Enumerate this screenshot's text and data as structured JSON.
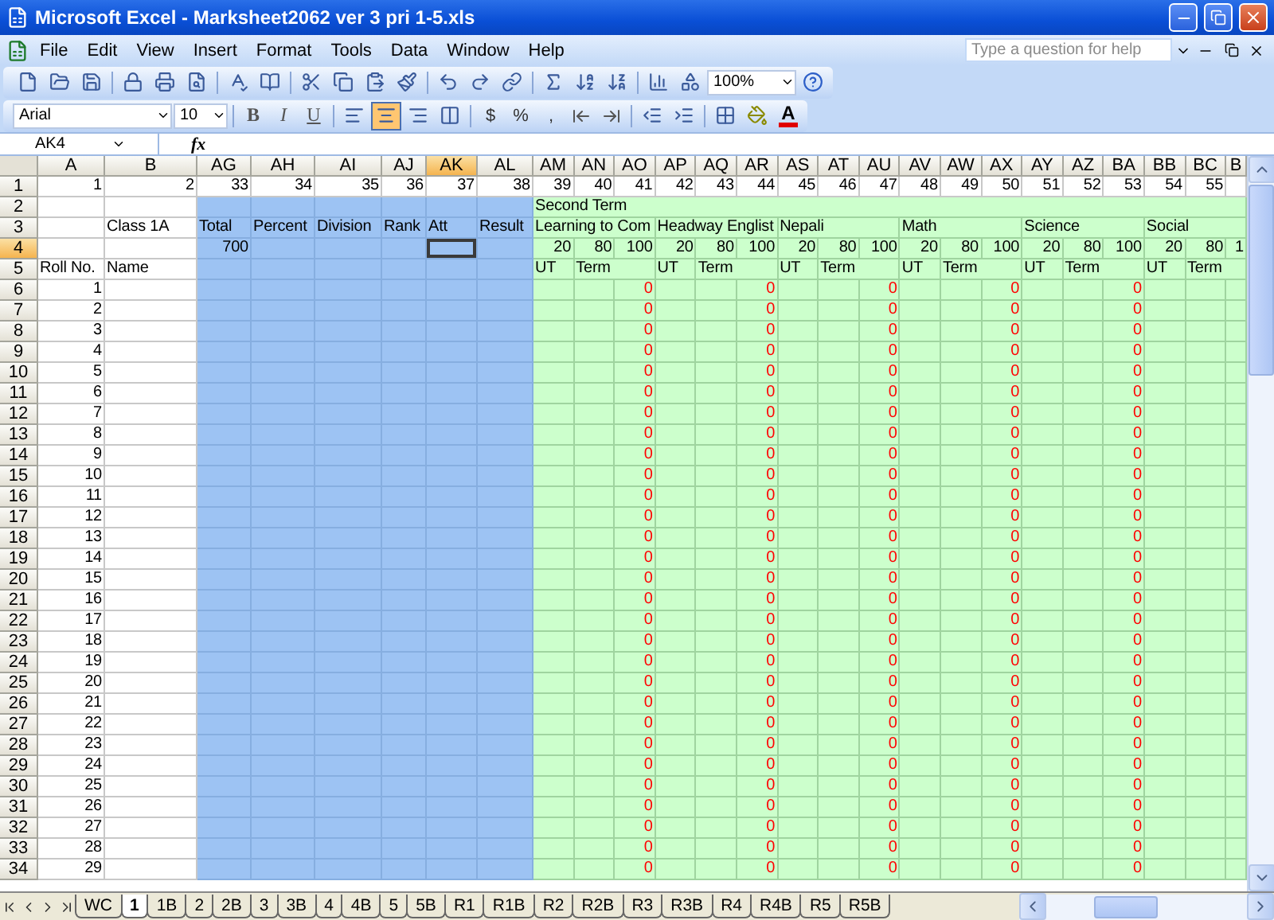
{
  "window": {
    "title": "Microsoft Excel - Marksheet2062 ver 3 pri 1-5.xls"
  },
  "menu": [
    "File",
    "Edit",
    "View",
    "Insert",
    "Format",
    "Tools",
    "Data",
    "Window",
    "Help"
  ],
  "help": {
    "placeholder": "Type a question for help"
  },
  "toolbar": {
    "zoom": "100%"
  },
  "formatting": {
    "font": "Arial",
    "size": "10",
    "styles": [
      "B",
      "I",
      "U"
    ],
    "number_formats": [
      "$",
      "%",
      ","
    ],
    "alignment": [
      {
        "kind": "left",
        "selected": false
      },
      {
        "kind": "center",
        "selected": true
      },
      {
        "kind": "right",
        "selected": false
      },
      {
        "kind": "merge",
        "selected": false
      }
    ],
    "font_color": "A"
  },
  "formula_bar": {
    "name_box": "AK4",
    "label": "fx"
  },
  "columns": [
    {
      "label": "A",
      "selected": false,
      "kind": "plain"
    },
    {
      "label": "B",
      "selected": false,
      "kind": "plain"
    },
    {
      "label": "AG",
      "selected": false,
      "kind": "summary"
    },
    {
      "label": "AH",
      "selected": false,
      "kind": "summary"
    },
    {
      "label": "AI",
      "selected": false,
      "kind": "summary"
    },
    {
      "label": "AJ",
      "selected": false,
      "kind": "summary"
    },
    {
      "label": "AK",
      "selected": true,
      "kind": "summary"
    },
    {
      "label": "AL",
      "selected": false,
      "kind": "summary"
    },
    {
      "label": "AM",
      "selected": false,
      "kind": "marks"
    },
    {
      "label": "AN",
      "selected": false,
      "kind": "marks"
    },
    {
      "label": "AO",
      "selected": false,
      "kind": "total"
    },
    {
      "label": "AP",
      "selected": false,
      "kind": "marks"
    },
    {
      "label": "AQ",
      "selected": false,
      "kind": "marks"
    },
    {
      "label": "AR",
      "selected": false,
      "kind": "total"
    },
    {
      "label": "AS",
      "selected": false,
      "kind": "marks"
    },
    {
      "label": "AT",
      "selected": false,
      "kind": "marks"
    },
    {
      "label": "AU",
      "selected": false,
      "kind": "total"
    },
    {
      "label": "AV",
      "selected": false,
      "kind": "marks"
    },
    {
      "label": "AW",
      "selected": false,
      "kind": "marks"
    },
    {
      "label": "AX",
      "selected": false,
      "kind": "total"
    },
    {
      "label": "AY",
      "selected": false,
      "kind": "marks"
    },
    {
      "label": "AZ",
      "selected": false,
      "kind": "marks"
    },
    {
      "label": "BA",
      "selected": false,
      "kind": "total"
    },
    {
      "label": "BB",
      "selected": false,
      "kind": "marks"
    },
    {
      "label": "BC",
      "selected": false,
      "kind": "marks"
    },
    {
      "label": "B",
      "selected": false,
      "kind": "marks"
    }
  ],
  "rows": [
    {
      "header": "1",
      "selected": false,
      "kind": "numbers",
      "cells": [
        "1",
        "2",
        "33",
        "34",
        "35",
        "36",
        "37",
        "38",
        "39",
        "40",
        "41",
        "42",
        "43",
        "44",
        "45",
        "46",
        "47",
        "48",
        "49",
        "50",
        "51",
        "52",
        "53",
        "54",
        "55",
        ""
      ]
    },
    {
      "header": "2",
      "selected": false,
      "kind": "header",
      "cells": [
        "",
        "",
        "",
        "",
        "",
        "",
        "",
        "",
        "Second Term",
        "",
        "",
        "",
        "",
        "",
        "",
        "",
        "",
        "",
        "",
        "",
        "",
        "",
        "",
        "",
        "",
        ""
      ]
    },
    {
      "header": "3",
      "selected": false,
      "kind": "header",
      "cells": [
        "",
        "Class 1A",
        "Total",
        "Percent",
        "Division",
        "Rank",
        "Att",
        "Result",
        "Learning to Com",
        "",
        "",
        "Headway Englist",
        "",
        "",
        "Nepali",
        "",
        "",
        "Math",
        "",
        "",
        "Science",
        "",
        "",
        "Social",
        "",
        ""
      ]
    },
    {
      "header": "4",
      "selected": true,
      "kind": "header",
      "cells": [
        "",
        "",
        "700",
        "",
        "",
        "",
        "",
        "",
        "20",
        "80",
        "100",
        "20",
        "80",
        "100",
        "20",
        "80",
        "100",
        "20",
        "80",
        "100",
        "20",
        "80",
        "100",
        "20",
        "80",
        "1"
      ]
    },
    {
      "header": "5",
      "selected": false,
      "kind": "header",
      "cells": [
        "Roll No.",
        "Name",
        "",
        "",
        "",
        "",
        "",
        "",
        "UT",
        "Term",
        "",
        "UT",
        "Term",
        "",
        "UT",
        "Term",
        "",
        "UT",
        "Term",
        "",
        "UT",
        "Term",
        "",
        "UT",
        "Term",
        ""
      ]
    },
    {
      "header": "6",
      "selected": false,
      "kind": "data",
      "cells": [
        "1",
        "",
        "",
        "",
        "",
        "",
        "",
        "",
        "",
        "",
        "0",
        "",
        "",
        "0",
        "",
        "",
        "0",
        "",
        "",
        "0",
        "",
        "",
        "0",
        "",
        "",
        ""
      ]
    },
    {
      "header": "7",
      "selected": false,
      "kind": "data",
      "cells": [
        "2",
        "",
        "",
        "",
        "",
        "",
        "",
        "",
        "",
        "",
        "0",
        "",
        "",
        "0",
        "",
        "",
        "0",
        "",
        "",
        "0",
        "",
        "",
        "0",
        "",
        "",
        ""
      ]
    },
    {
      "header": "8",
      "selected": false,
      "kind": "data",
      "cells": [
        "3",
        "",
        "",
        "",
        "",
        "",
        "",
        "",
        "",
        "",
        "0",
        "",
        "",
        "0",
        "",
        "",
        "0",
        "",
        "",
        "0",
        "",
        "",
        "0",
        "",
        "",
        ""
      ]
    },
    {
      "header": "9",
      "selected": false,
      "kind": "data",
      "cells": [
        "4",
        "",
        "",
        "",
        "",
        "",
        "",
        "",
        "",
        "",
        "0",
        "",
        "",
        "0",
        "",
        "",
        "0",
        "",
        "",
        "0",
        "",
        "",
        "0",
        "",
        "",
        ""
      ]
    },
    {
      "header": "10",
      "selected": false,
      "kind": "data",
      "cells": [
        "5",
        "",
        "",
        "",
        "",
        "",
        "",
        "",
        "",
        "",
        "0",
        "",
        "",
        "0",
        "",
        "",
        "0",
        "",
        "",
        "0",
        "",
        "",
        "0",
        "",
        "",
        ""
      ]
    },
    {
      "header": "11",
      "selected": false,
      "kind": "data",
      "cells": [
        "6",
        "",
        "",
        "",
        "",
        "",
        "",
        "",
        "",
        "",
        "0",
        "",
        "",
        "0",
        "",
        "",
        "0",
        "",
        "",
        "0",
        "",
        "",
        "0",
        "",
        "",
        ""
      ]
    },
    {
      "header": "12",
      "selected": false,
      "kind": "data",
      "cells": [
        "7",
        "",
        "",
        "",
        "",
        "",
        "",
        "",
        "",
        "",
        "0",
        "",
        "",
        "0",
        "",
        "",
        "0",
        "",
        "",
        "0",
        "",
        "",
        "0",
        "",
        "",
        ""
      ]
    },
    {
      "header": "13",
      "selected": false,
      "kind": "data",
      "cells": [
        "8",
        "",
        "",
        "",
        "",
        "",
        "",
        "",
        "",
        "",
        "0",
        "",
        "",
        "0",
        "",
        "",
        "0",
        "",
        "",
        "0",
        "",
        "",
        "0",
        "",
        "",
        ""
      ]
    },
    {
      "header": "14",
      "selected": false,
      "kind": "data",
      "cells": [
        "9",
        "",
        "",
        "",
        "",
        "",
        "",
        "",
        "",
        "",
        "0",
        "",
        "",
        "0",
        "",
        "",
        "0",
        "",
        "",
        "0",
        "",
        "",
        "0",
        "",
        "",
        ""
      ]
    },
    {
      "header": "15",
      "selected": false,
      "kind": "data",
      "cells": [
        "10",
        "",
        "",
        "",
        "",
        "",
        "",
        "",
        "",
        "",
        "0",
        "",
        "",
        "0",
        "",
        "",
        "0",
        "",
        "",
        "0",
        "",
        "",
        "0",
        "",
        "",
        ""
      ]
    },
    {
      "header": "16",
      "selected": false,
      "kind": "data",
      "cells": [
        "11",
        "",
        "",
        "",
        "",
        "",
        "",
        "",
        "",
        "",
        "0",
        "",
        "",
        "0",
        "",
        "",
        "0",
        "",
        "",
        "0",
        "",
        "",
        "0",
        "",
        "",
        ""
      ]
    },
    {
      "header": "17",
      "selected": false,
      "kind": "data",
      "cells": [
        "12",
        "",
        "",
        "",
        "",
        "",
        "",
        "",
        "",
        "",
        "0",
        "",
        "",
        "0",
        "",
        "",
        "0",
        "",
        "",
        "0",
        "",
        "",
        "0",
        "",
        "",
        ""
      ]
    },
    {
      "header": "18",
      "selected": false,
      "kind": "data",
      "cells": [
        "13",
        "",
        "",
        "",
        "",
        "",
        "",
        "",
        "",
        "",
        "0",
        "",
        "",
        "0",
        "",
        "",
        "0",
        "",
        "",
        "0",
        "",
        "",
        "0",
        "",
        "",
        ""
      ]
    },
    {
      "header": "19",
      "selected": false,
      "kind": "data",
      "cells": [
        "14",
        "",
        "",
        "",
        "",
        "",
        "",
        "",
        "",
        "",
        "0",
        "",
        "",
        "0",
        "",
        "",
        "0",
        "",
        "",
        "0",
        "",
        "",
        "0",
        "",
        "",
        ""
      ]
    },
    {
      "header": "20",
      "selected": false,
      "kind": "data",
      "cells": [
        "15",
        "",
        "",
        "",
        "",
        "",
        "",
        "",
        "",
        "",
        "0",
        "",
        "",
        "0",
        "",
        "",
        "0",
        "",
        "",
        "0",
        "",
        "",
        "0",
        "",
        "",
        ""
      ]
    },
    {
      "header": "21",
      "selected": false,
      "kind": "data",
      "cells": [
        "16",
        "",
        "",
        "",
        "",
        "",
        "",
        "",
        "",
        "",
        "0",
        "",
        "",
        "0",
        "",
        "",
        "0",
        "",
        "",
        "0",
        "",
        "",
        "0",
        "",
        "",
        ""
      ]
    },
    {
      "header": "22",
      "selected": false,
      "kind": "data",
      "cells": [
        "17",
        "",
        "",
        "",
        "",
        "",
        "",
        "",
        "",
        "",
        "0",
        "",
        "",
        "0",
        "",
        "",
        "0",
        "",
        "",
        "0",
        "",
        "",
        "0",
        "",
        "",
        ""
      ]
    },
    {
      "header": "23",
      "selected": false,
      "kind": "data",
      "cells": [
        "18",
        "",
        "",
        "",
        "",
        "",
        "",
        "",
        "",
        "",
        "0",
        "",
        "",
        "0",
        "",
        "",
        "0",
        "",
        "",
        "0",
        "",
        "",
        "0",
        "",
        "",
        ""
      ]
    },
    {
      "header": "24",
      "selected": false,
      "kind": "data",
      "cells": [
        "19",
        "",
        "",
        "",
        "",
        "",
        "",
        "",
        "",
        "",
        "0",
        "",
        "",
        "0",
        "",
        "",
        "0",
        "",
        "",
        "0",
        "",
        "",
        "0",
        "",
        "",
        ""
      ]
    },
    {
      "header": "25",
      "selected": false,
      "kind": "data",
      "cells": [
        "20",
        "",
        "",
        "",
        "",
        "",
        "",
        "",
        "",
        "",
        "0",
        "",
        "",
        "0",
        "",
        "",
        "0",
        "",
        "",
        "0",
        "",
        "",
        "0",
        "",
        "",
        ""
      ]
    },
    {
      "header": "26",
      "selected": false,
      "kind": "data",
      "cells": [
        "21",
        "",
        "",
        "",
        "",
        "",
        "",
        "",
        "",
        "",
        "0",
        "",
        "",
        "0",
        "",
        "",
        "0",
        "",
        "",
        "0",
        "",
        "",
        "0",
        "",
        "",
        ""
      ]
    },
    {
      "header": "27",
      "selected": false,
      "kind": "data",
      "cells": [
        "22",
        "",
        "",
        "",
        "",
        "",
        "",
        "",
        "",
        "",
        "0",
        "",
        "",
        "0",
        "",
        "",
        "0",
        "",
        "",
        "0",
        "",
        "",
        "0",
        "",
        "",
        ""
      ]
    },
    {
      "header": "28",
      "selected": false,
      "kind": "data",
      "cells": [
        "23",
        "",
        "",
        "",
        "",
        "",
        "",
        "",
        "",
        "",
        "0",
        "",
        "",
        "0",
        "",
        "",
        "0",
        "",
        "",
        "0",
        "",
        "",
        "0",
        "",
        "",
        ""
      ]
    },
    {
      "header": "29",
      "selected": false,
      "kind": "data",
      "cells": [
        "24",
        "",
        "",
        "",
        "",
        "",
        "",
        "",
        "",
        "",
        "0",
        "",
        "",
        "0",
        "",
        "",
        "0",
        "",
        "",
        "0",
        "",
        "",
        "0",
        "",
        "",
        ""
      ]
    },
    {
      "header": "30",
      "selected": false,
      "kind": "data",
      "cells": [
        "25",
        "",
        "",
        "",
        "",
        "",
        "",
        "",
        "",
        "",
        "0",
        "",
        "",
        "0",
        "",
        "",
        "0",
        "",
        "",
        "0",
        "",
        "",
        "0",
        "",
        "",
        ""
      ]
    },
    {
      "header": "31",
      "selected": false,
      "kind": "data",
      "cells": [
        "26",
        "",
        "",
        "",
        "",
        "",
        "",
        "",
        "",
        "",
        "0",
        "",
        "",
        "0",
        "",
        "",
        "0",
        "",
        "",
        "0",
        "",
        "",
        "0",
        "",
        "",
        ""
      ]
    },
    {
      "header": "32",
      "selected": false,
      "kind": "data",
      "cells": [
        "27",
        "",
        "",
        "",
        "",
        "",
        "",
        "",
        "",
        "",
        "0",
        "",
        "",
        "0",
        "",
        "",
        "0",
        "",
        "",
        "0",
        "",
        "",
        "0",
        "",
        "",
        ""
      ]
    },
    {
      "header": "33",
      "selected": false,
      "kind": "data",
      "cells": [
        "28",
        "",
        "",
        "",
        "",
        "",
        "",
        "",
        "",
        "",
        "0",
        "",
        "",
        "0",
        "",
        "",
        "0",
        "",
        "",
        "0",
        "",
        "",
        "0",
        "",
        "",
        ""
      ]
    },
    {
      "header": "34",
      "selected": false,
      "kind": "data",
      "cells": [
        "29",
        "",
        "",
        "",
        "",
        "",
        "",
        "",
        "",
        "",
        "0",
        "",
        "",
        "0",
        "",
        "",
        "0",
        "",
        "",
        "0",
        "",
        "",
        "0",
        "",
        "",
        ""
      ]
    }
  ],
  "sheet_tabs": [
    {
      "label": "WC",
      "selected": false
    },
    {
      "label": "1",
      "selected": true
    },
    {
      "label": "1B",
      "selected": false
    },
    {
      "label": "2",
      "selected": false
    },
    {
      "label": "2B",
      "selected": false
    },
    {
      "label": "3",
      "selected": false
    },
    {
      "label": "3B",
      "selected": false
    },
    {
      "label": "4",
      "selected": false
    },
    {
      "label": "4B",
      "selected": false
    },
    {
      "label": "5",
      "selected": false
    },
    {
      "label": "5B",
      "selected": false
    },
    {
      "label": "R1",
      "selected": false
    },
    {
      "label": "R1B",
      "selected": false
    },
    {
      "label": "R2",
      "selected": false
    },
    {
      "label": "R2B",
      "selected": false
    },
    {
      "label": "R3",
      "selected": false
    },
    {
      "label": "R3B",
      "selected": false
    },
    {
      "label": "R4",
      "selected": false
    },
    {
      "label": "R4B",
      "selected": false
    },
    {
      "label": "R5",
      "selected": false
    },
    {
      "label": "R5B",
      "selected": false
    }
  ]
}
